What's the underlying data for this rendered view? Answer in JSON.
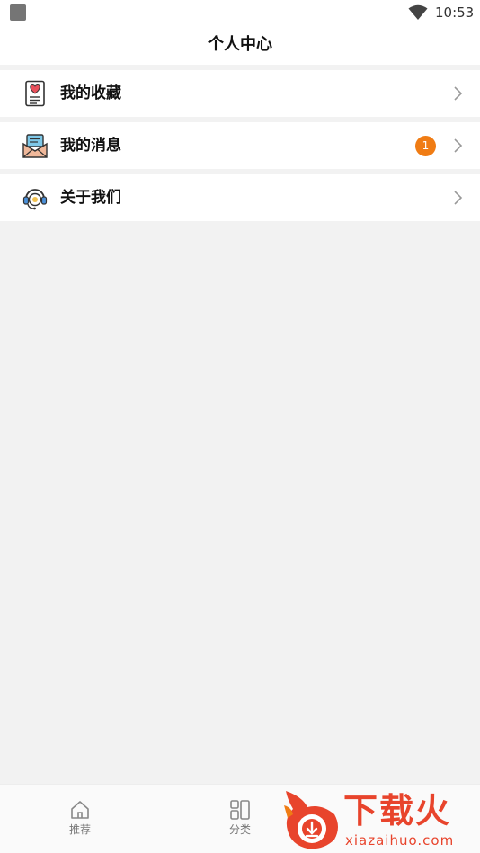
{
  "status_bar": {
    "time": "10:53"
  },
  "header": {
    "title": "个人中心"
  },
  "menu": [
    {
      "label": "我的收藏",
      "icon": "favorites-heart-document-icon"
    },
    {
      "label": "我的消息",
      "icon": "message-envelope-icon",
      "badge": "1"
    },
    {
      "label": "关于我们",
      "icon": "customer-service-headset-icon"
    }
  ],
  "tabs": [
    {
      "label": "推荐",
      "icon": "home-icon"
    },
    {
      "label": "分类",
      "icon": "category-grid-icon"
    }
  ],
  "watermark": {
    "brand": "下载火",
    "url": "xiazaihuo.com"
  },
  "colors": {
    "accent": "#f07c14",
    "brand": "#e8442c"
  }
}
